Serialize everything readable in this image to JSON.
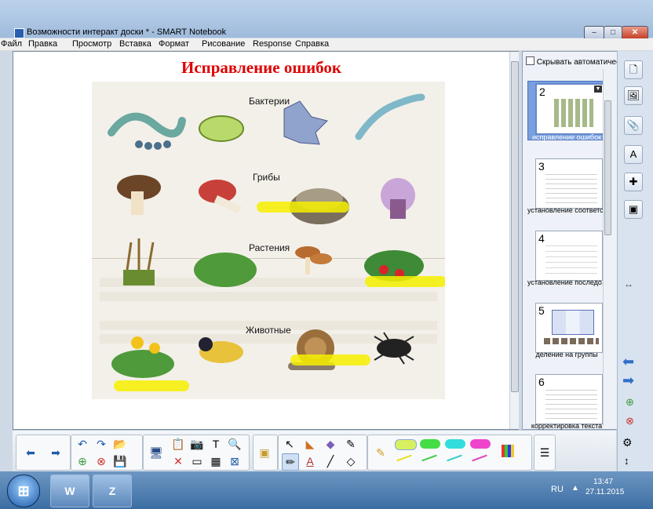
{
  "window": {
    "title": "Возможности интеракт доски * - SMART Notebook",
    "btn_min": "‒",
    "btn_max": "□",
    "btn_close": "✕"
  },
  "menu": [
    "Файл",
    "Правка",
    "Просмотр",
    "Вставка",
    "Формат",
    "Рисование",
    "Response",
    "Справка"
  ],
  "page": {
    "title": "Исправление ошибок",
    "sections": [
      "Бактерии",
      "Грибы",
      "Растения",
      "Животные"
    ],
    "highlight_color": "#f6f000",
    "title_color": "#e00000"
  },
  "panel": {
    "autohide_label": "Скрывать автоматическ",
    "slides": [
      {
        "num": "2",
        "caption": "исправление ошибок",
        "selected": true
      },
      {
        "num": "3",
        "caption": "установление соответс..."
      },
      {
        "num": "4",
        "caption": "установление последо..."
      },
      {
        "num": "5",
        "caption": "деление на группы"
      },
      {
        "num": "6",
        "caption": "корректировка текста"
      }
    ]
  },
  "toolbar": {
    "groups": [
      {
        "name": "navigation",
        "icons": [
          "arrow-left-icon",
          "arrow-right-icon"
        ]
      },
      {
        "name": "edit",
        "icons": [
          "undo-icon",
          "redo-icon",
          "open-file-icon",
          "add-page-icon",
          "delete-page-icon",
          "save-icon"
        ]
      },
      {
        "name": "display",
        "icons": [
          "screen-icon",
          "paste-icon",
          "screen-shade-icon",
          "table-icon",
          "delete-icon",
          "text-recognition-icon"
        ]
      },
      {
        "name": "tools",
        "icons": [
          "select-icon",
          "fill-icon",
          "eraser-icon",
          "magic-pen-icon",
          "creative-pen-icon",
          "text-icon",
          "line-icon",
          "shape-icon"
        ]
      },
      {
        "name": "pens",
        "colors": [
          "#f6f000",
          "#44dd44",
          "#33dddd",
          "#ee44cc"
        ]
      }
    ]
  },
  "taskbar": {
    "start_label": "⊞",
    "tasks": [
      "W",
      "Z"
    ],
    "lang": "RU",
    "time": "13:47",
    "date": "27.11.2015"
  }
}
